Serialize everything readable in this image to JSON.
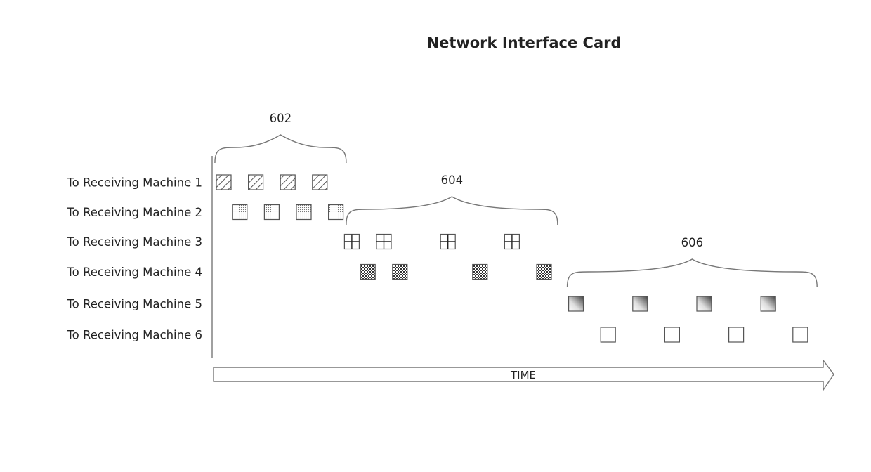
{
  "title": "Network Interface Card",
  "time_label": "TIME",
  "rows": [
    {
      "label": "To Receiving Machine 1",
      "pattern": "diagonal-hatch",
      "packets": [
        0,
        1,
        2,
        3
      ]
    },
    {
      "label": "To Receiving Machine 2",
      "pattern": "fine-dots",
      "packets": [
        0.5,
        1.5,
        2.5,
        3.5
      ]
    },
    {
      "label": "To Receiving Machine 3",
      "pattern": "grid-cross",
      "packets": [
        4,
        5,
        7,
        9
      ]
    },
    {
      "label": "To Receiving Machine 4",
      "pattern": "dense-checker",
      "packets": [
        4.5,
        5.5,
        8,
        10
      ]
    },
    {
      "label": "To Receiving Machine 5",
      "pattern": "gradient",
      "packets": [
        11,
        13,
        15,
        17
      ]
    },
    {
      "label": "To Receiving Machine 6",
      "pattern": "empty",
      "packets": [
        12,
        14,
        16,
        18
      ]
    }
  ],
  "groups": [
    {
      "label": "602",
      "from": -0.1,
      "to": 4.0
    },
    {
      "label": "604",
      "from": 4.0,
      "to": 10.6
    },
    {
      "label": "606",
      "from": 10.9,
      "to": 18.7
    }
  ]
}
